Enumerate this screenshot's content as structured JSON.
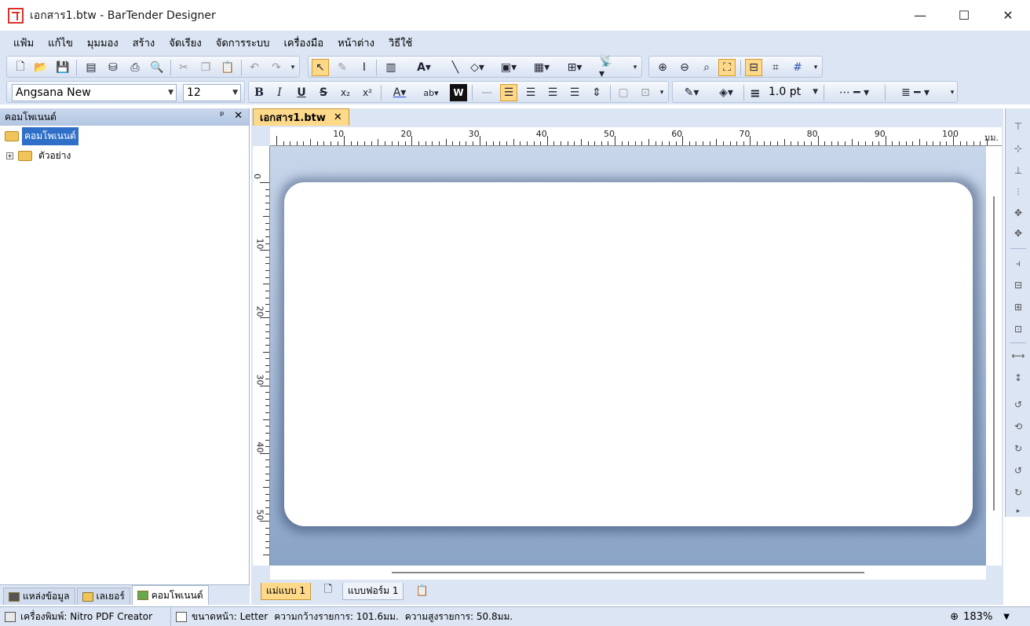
{
  "window": {
    "title": "เอกสาร1.btw - BarTender Designer",
    "minimize": "—",
    "maximize": "☐",
    "close": "✕"
  },
  "menu": [
    "แฟ้ม",
    "แก้ไข",
    "มุมมอง",
    "สร้าง",
    "จัดเรียง",
    "จัดการระบบ",
    "เครื่องมือ",
    "หน้าต่าง",
    "วิธีใช้"
  ],
  "format_toolbar": {
    "font_name": "Angsana New",
    "font_size": "12",
    "line_width": "1.0 pt"
  },
  "left_panel": {
    "title": "คอมโพเนนต์",
    "pin": "ᵖ",
    "close": "✕",
    "tree_root": "คอมโพเนนต์",
    "tree_child": "ตัวอย่าง",
    "tabs": [
      "แหล่งข้อมูล",
      "เลเยอร์",
      "คอมโพเนนต์"
    ]
  },
  "document": {
    "tab_title": "เอกสาร1.btw",
    "tab_close": "✕",
    "ruler_unit": "มม.",
    "ruler_top_labels": [
      "10",
      "20",
      "30",
      "40",
      "50",
      "60",
      "70",
      "80",
      "90",
      "100"
    ],
    "ruler_left_labels": [
      "0",
      "10",
      "20",
      "30",
      "40",
      "50"
    ],
    "bottom_tabs": [
      "แม่แบบ 1",
      "แบบฟอร์ม 1"
    ]
  },
  "statusbar": {
    "printer": "เครื่องพิมพ์: Nitro PDF Creator",
    "page_size": "ขนาดหน้า: Letter",
    "item_width": "ความกว้างรายการ: 101.6มม.",
    "item_height": "ความสูงรายการ: 50.8มม.",
    "zoom": "183%"
  },
  "colors": {
    "accent_active": "#ffd98a",
    "chrome": "#dbe5f3",
    "selection": "#2f6fc8"
  },
  "icons": {
    "toolbar1": [
      "new-icon",
      "open-icon",
      "save-icon",
      "page-setup-icon",
      "database-icon",
      "print-icon",
      "print-preview-icon",
      "cut-icon",
      "copy-icon",
      "paste-icon",
      "undo-icon",
      "redo-icon",
      "pointer-icon",
      "brush-icon",
      "text-cursor-icon",
      "barcode-icon",
      "text-icon",
      "line-icon",
      "shape-icon",
      "picture-icon",
      "table-icon",
      "grid-icon",
      "rfid-icon",
      "zoom-in-icon",
      "zoom-out-icon",
      "zoom-area-icon",
      "zoom-fit-icon",
      "ruler-icon",
      "snap-icon",
      "gridlines-icon"
    ],
    "toolbar2": [
      "bold-icon",
      "italic-icon",
      "underline-icon",
      "strikethrough-icon",
      "subscript-icon",
      "superscript-icon",
      "font-color-icon",
      "highlight-icon",
      "word-icon",
      "align-left-icon",
      "align-center-icon",
      "align-right-icon",
      "justify-icon",
      "fit-icon",
      "line-color-icon",
      "fill-color-icon",
      "line-weight-icon",
      "dash-style-icon",
      "border-style-icon"
    ]
  }
}
